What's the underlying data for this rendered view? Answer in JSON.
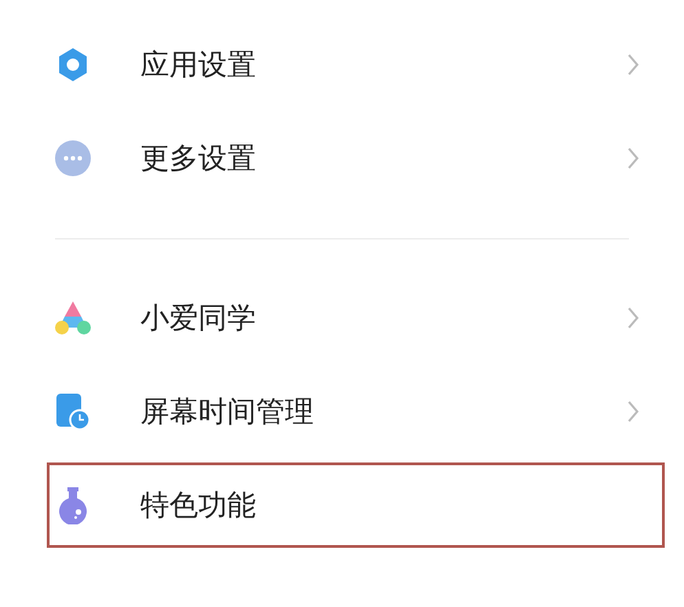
{
  "groups": [
    {
      "items": [
        {
          "kind": "gear",
          "label": "应用设置",
          "chevron": true,
          "selected": false
        },
        {
          "kind": "more",
          "label": "更多设置",
          "chevron": true,
          "selected": false
        }
      ]
    },
    {
      "items": [
        {
          "kind": "assistant",
          "label": "小爱同学",
          "chevron": true,
          "selected": false
        },
        {
          "kind": "screentime",
          "label": "屏幕时间管理",
          "chevron": true,
          "selected": false
        },
        {
          "kind": "flask",
          "label": "特色功能",
          "chevron": false,
          "selected": true
        }
      ]
    }
  ]
}
